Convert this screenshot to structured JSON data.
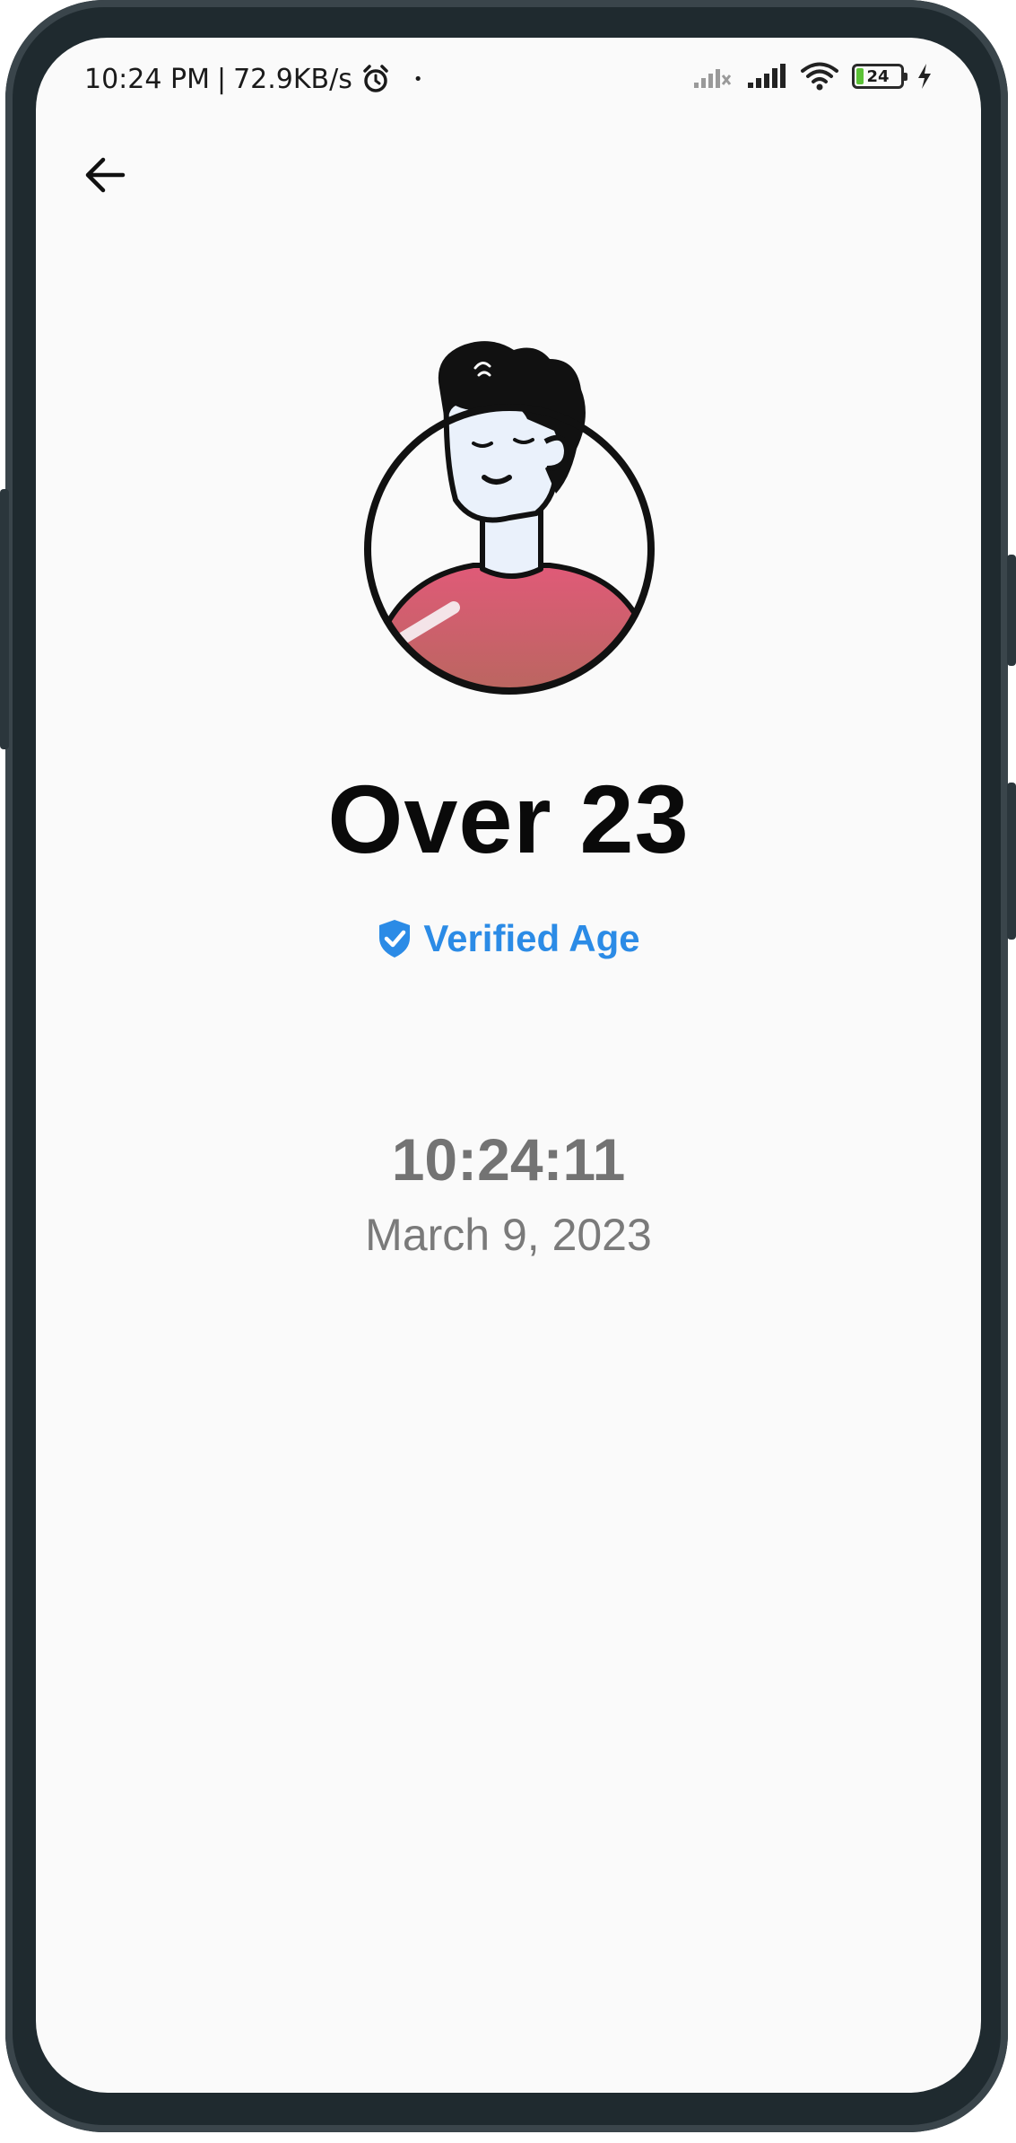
{
  "status_bar": {
    "time": "10:24 PM",
    "separator": "|",
    "network_speed": "72.9KB/s",
    "dot": "•",
    "battery_level": "24",
    "battery_fraction": 0.24,
    "battery_color": "#5bc236",
    "icons": [
      "alarm-icon",
      "signal-no-service-icon",
      "signal-icon",
      "wifi-icon",
      "battery-icon",
      "charging-icon"
    ]
  },
  "navigation": {
    "back_icon": "arrow-left-icon"
  },
  "profile": {
    "avatar": "avatar-illustration",
    "headline": "Over 23",
    "verified_label": "Verified Age",
    "verified_icon": "shield-check-icon",
    "verified_color": "#2b8be6"
  },
  "timestamp": {
    "time": "10:24:11",
    "date": "March 9, 2023"
  }
}
